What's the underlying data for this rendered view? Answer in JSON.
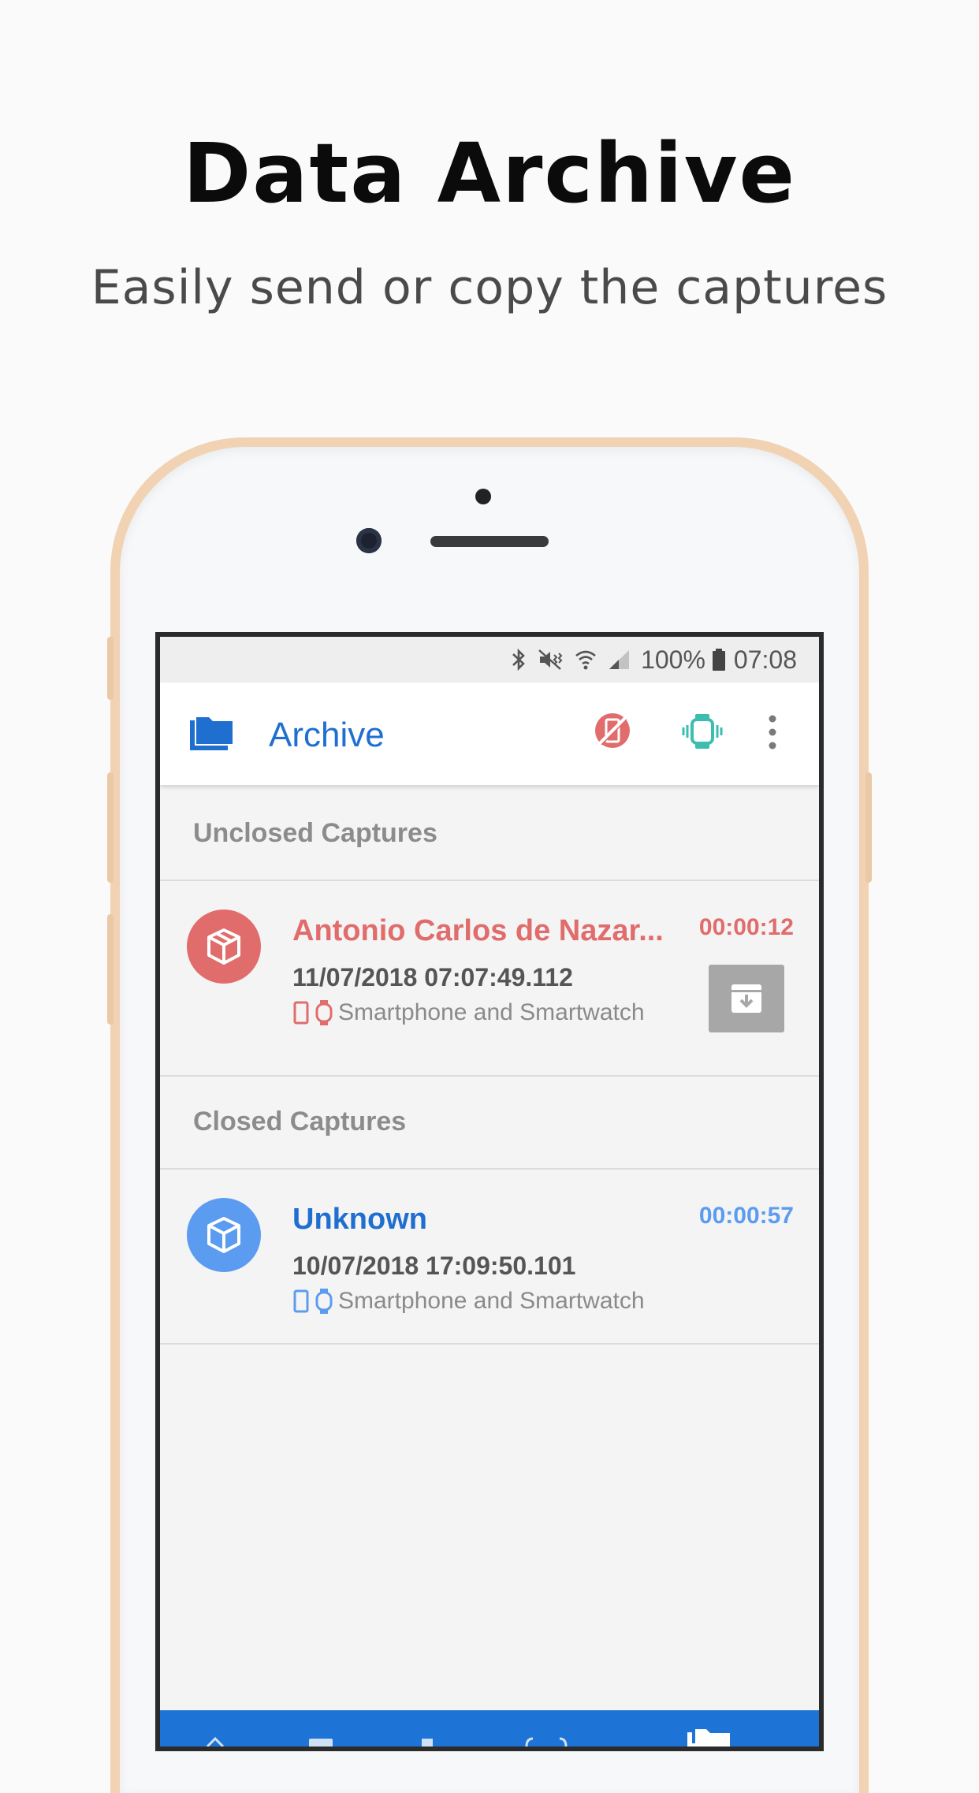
{
  "hero": {
    "title": "Data Archive",
    "subtitle": "Easily send or copy the captures"
  },
  "status_bar": {
    "battery": "100%",
    "time": "07:08",
    "icons": [
      "bluetooth-icon",
      "mute-vibrate-icon",
      "wifi-icon",
      "signal-icon",
      "battery-icon"
    ]
  },
  "app_bar": {
    "icon": "folder-icon",
    "title": "Archive",
    "actions": [
      "no-phone-icon",
      "smartwatch-icon",
      "more-vert-icon"
    ]
  },
  "sections": {
    "unclosed": {
      "title": "Unclosed Captures",
      "items": [
        {
          "name": "Antonio Carlos de Nazar...",
          "duration": "00:00:12",
          "datetime": "11/07/2018 07:07:49.112",
          "devices": "Smartphone and Smartwatch",
          "color": "#e06c6c"
        }
      ]
    },
    "closed": {
      "title": "Closed Captures",
      "items": [
        {
          "name": "Unknown",
          "duration": "00:00:57",
          "datetime": "10/07/2018 17:09:50.101",
          "devices": "Smartphone and Smartwatch",
          "color": "#1f6fd1"
        }
      ]
    }
  },
  "colors": {
    "primary": "#1f6fd1",
    "unclosed_accent": "#e06c6c",
    "closed_avatar": "#5c9cf0",
    "watch_accent": "#3dbdb0",
    "bottom_nav": "#1e74d6"
  }
}
